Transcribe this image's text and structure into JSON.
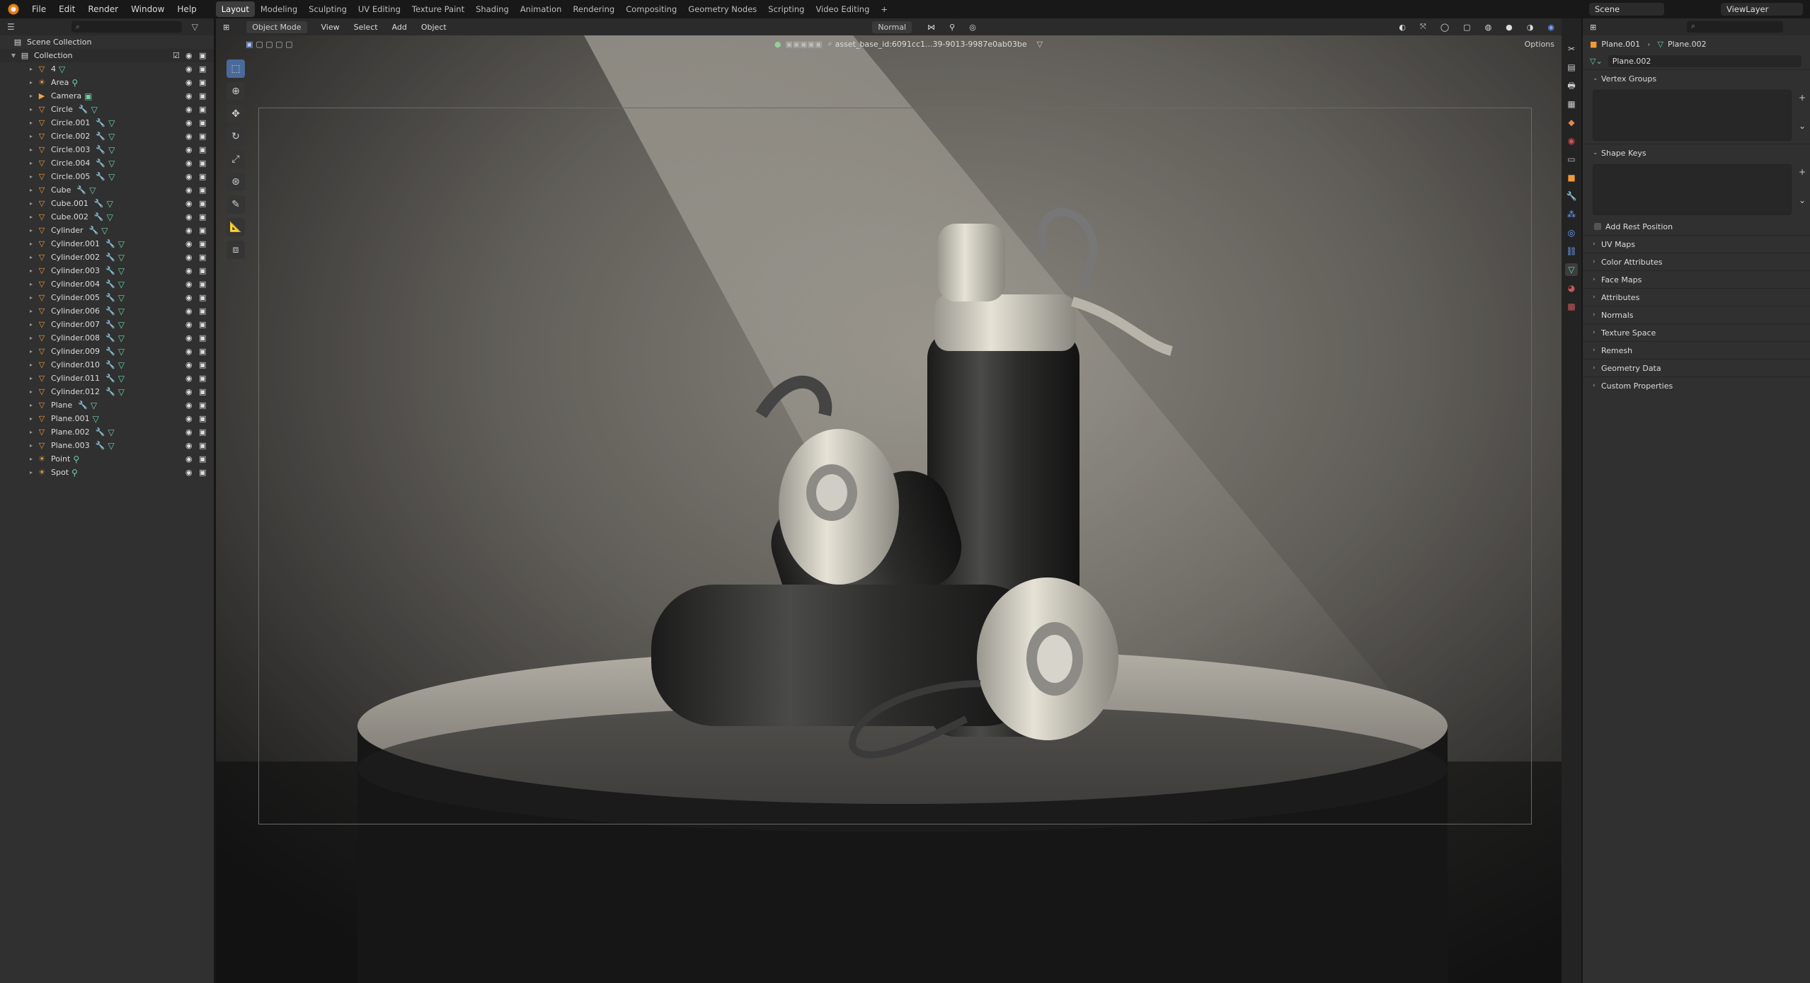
{
  "topbar": {
    "menus": [
      "File",
      "Edit",
      "Render",
      "Window",
      "Help"
    ],
    "workspaces": [
      "Layout",
      "Modeling",
      "Sculpting",
      "UV Editing",
      "Texture Paint",
      "Shading",
      "Animation",
      "Rendering",
      "Compositing",
      "Geometry Nodes",
      "Scripting",
      "Video Editing",
      "+"
    ],
    "active_workspace": "Layout",
    "scene": "Scene",
    "view_layer": "ViewLayer"
  },
  "outliner": {
    "root": "Scene Collection",
    "collection": "Collection",
    "items": [
      {
        "name": "4",
        "type": "mesh",
        "data": true,
        "mods": false
      },
      {
        "name": "Area",
        "type": "light",
        "data": true,
        "mods": false
      },
      {
        "name": "Camera",
        "type": "camera",
        "data": true,
        "mods": false
      },
      {
        "name": "Circle",
        "type": "mesh",
        "data": true,
        "mods": true
      },
      {
        "name": "Circle.001",
        "type": "mesh",
        "data": true,
        "mods": true
      },
      {
        "name": "Circle.002",
        "type": "mesh",
        "data": true,
        "mods": true
      },
      {
        "name": "Circle.003",
        "type": "mesh",
        "data": true,
        "mods": true
      },
      {
        "name": "Circle.004",
        "type": "mesh",
        "data": true,
        "mods": true
      },
      {
        "name": "Circle.005",
        "type": "mesh",
        "data": true,
        "mods": true
      },
      {
        "name": "Cube",
        "type": "mesh",
        "data": true,
        "mods": true
      },
      {
        "name": "Cube.001",
        "type": "mesh",
        "data": true,
        "mods": true
      },
      {
        "name": "Cube.002",
        "type": "mesh",
        "data": true,
        "mods": true
      },
      {
        "name": "Cylinder",
        "type": "mesh",
        "data": true,
        "mods": true
      },
      {
        "name": "Cylinder.001",
        "type": "mesh",
        "data": true,
        "mods": true
      },
      {
        "name": "Cylinder.002",
        "type": "mesh",
        "data": true,
        "mods": true
      },
      {
        "name": "Cylinder.003",
        "type": "mesh",
        "data": true,
        "mods": true
      },
      {
        "name": "Cylinder.004",
        "type": "mesh",
        "data": true,
        "mods": true
      },
      {
        "name": "Cylinder.005",
        "type": "mesh",
        "data": true,
        "mods": true
      },
      {
        "name": "Cylinder.006",
        "type": "mesh",
        "data": true,
        "mods": true
      },
      {
        "name": "Cylinder.007",
        "type": "mesh",
        "data": true,
        "mods": true
      },
      {
        "name": "Cylinder.008",
        "type": "mesh",
        "data": true,
        "mods": true
      },
      {
        "name": "Cylinder.009",
        "type": "mesh",
        "data": true,
        "mods": true
      },
      {
        "name": "Cylinder.010",
        "type": "mesh",
        "data": true,
        "mods": true
      },
      {
        "name": "Cylinder.011",
        "type": "mesh",
        "data": true,
        "mods": true
      },
      {
        "name": "Cylinder.012",
        "type": "mesh",
        "data": true,
        "mods": true
      },
      {
        "name": "Plane",
        "type": "mesh",
        "data": true,
        "mods": true
      },
      {
        "name": "Plane.001",
        "type": "mesh",
        "data": true,
        "mods": false
      },
      {
        "name": "Plane.002",
        "type": "mesh",
        "data": true,
        "mods": true
      },
      {
        "name": "Plane.003",
        "type": "mesh",
        "data": true,
        "mods": true
      },
      {
        "name": "Point",
        "type": "light",
        "data": true,
        "mods": false
      },
      {
        "name": "Spot",
        "type": "light",
        "data": true,
        "mods": false
      }
    ]
  },
  "viewport": {
    "mode": "Object Mode",
    "menus": [
      "View",
      "Select",
      "Add",
      "Object"
    ],
    "orientation": "Normal",
    "asset_id": "asset_base_id:6091cc1...39-9013-9987e0ab03be",
    "options": "Options"
  },
  "properties": {
    "breadcrumb_object": "Plane.001",
    "breadcrumb_data": "Plane.002",
    "data_name": "Plane.002",
    "vertex_groups": "Vertex Groups",
    "shape_keys": "Shape Keys",
    "add_rest_position": "Add Rest Position",
    "sections": [
      "UV Maps",
      "Color Attributes",
      "Face Maps",
      "Attributes",
      "Normals",
      "Texture Space",
      "Remesh",
      "Geometry Data",
      "Custom Properties"
    ]
  }
}
